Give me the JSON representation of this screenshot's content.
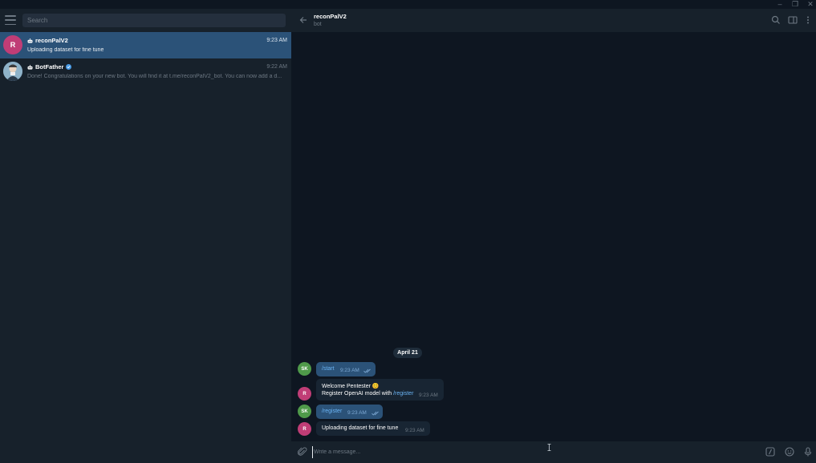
{
  "window": {
    "minimize_glyph": "–",
    "maximize_glyph": "❐",
    "close_glyph": "✕"
  },
  "sidebar": {
    "search_placeholder": "Search",
    "chats": [
      {
        "avatar_letter": "R",
        "avatar_color": "#c03d76",
        "name": "reconPalV2",
        "time": "9:23 AM",
        "preview": "Uploading dataset for fine tune",
        "active": true,
        "is_bot": true
      },
      {
        "avatar_letter": "",
        "avatar_color": "#5a7a9c",
        "name": "BotFather",
        "time": "9:22 AM",
        "preview": "Done! Congratulations on your new bot. You will find it at t.me/reconPalV2_bot. You can now add a d...",
        "active": false,
        "is_bot": true,
        "verified": true
      }
    ]
  },
  "header": {
    "name": "reconPalV2",
    "status": "bot"
  },
  "messages": {
    "date_chip": "April 21",
    "items": [
      {
        "sender": "SK",
        "sender_color": "#4f9a4a",
        "direction": "out",
        "text": "/start",
        "time": "9:23 AM",
        "read": true
      },
      {
        "sender": "R",
        "sender_color": "#c03d76",
        "direction": "in",
        "line1": "Welcome Pentester 😊",
        "line2_prefix": "Register OpenAI model with ",
        "line2_link": "/register",
        "time": "9:23 AM"
      },
      {
        "sender": "SK",
        "sender_color": "#4f9a4a",
        "direction": "out",
        "text": "/register",
        "time": "9:23 AM",
        "read": true
      },
      {
        "sender": "R",
        "sender_color": "#c03d76",
        "direction": "in",
        "text": "Uploading dataset for fine tune",
        "time": "9:23 AM"
      }
    ]
  },
  "composer": {
    "placeholder": "Write a message..."
  },
  "colors": {
    "accent": "#2b5278",
    "link": "#6ab3f3",
    "sidebar_bg": "#17212b",
    "chat_bg": "#0e1621"
  }
}
